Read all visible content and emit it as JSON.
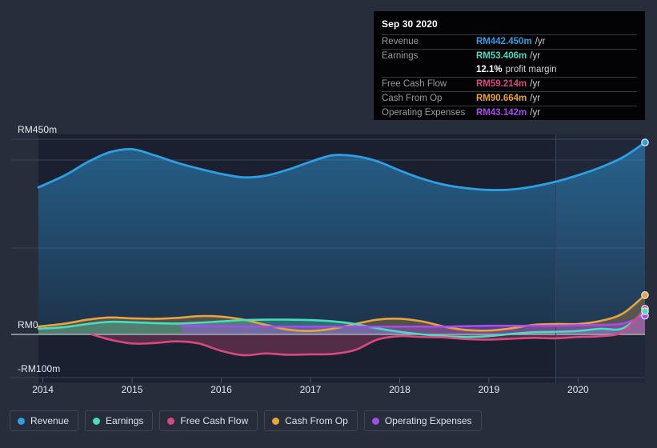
{
  "chart_data": {
    "type": "area",
    "title": "",
    "xlabel": "",
    "ylabel": "",
    "currency_prefix": "RM",
    "ylim": [
      -100,
      450
    ],
    "y_ticks": [
      {
        "value": 450,
        "label": "RM450m"
      },
      {
        "value": 0,
        "label": "RM0"
      },
      {
        "value": -100,
        "label": "-RM100m"
      }
    ],
    "x_ticks": [
      "2014",
      "2015",
      "2016",
      "2017",
      "2018",
      "2019",
      "2020"
    ],
    "grid": true,
    "legend_position": "bottom-left",
    "forecast_divider_year": 2019.75,
    "series": [
      {
        "name": "Revenue",
        "color": "#2f9fe3",
        "x": [
          2013.95,
          2014.25,
          2014.5,
          2014.75,
          2015.0,
          2015.25,
          2015.5,
          2015.75,
          2016.0,
          2016.25,
          2016.5,
          2016.75,
          2017.0,
          2017.25,
          2017.5,
          2017.75,
          2018.0,
          2018.25,
          2018.5,
          2018.75,
          2019.0,
          2019.25,
          2019.5,
          2019.75,
          2020.0,
          2020.25,
          2020.5,
          2020.75
        ],
        "values": [
          339,
          367,
          397,
          420,
          427,
          413,
          396,
          382,
          370,
          362,
          366,
          380,
          398,
          413,
          411,
          399,
          378,
          359,
          345,
          337,
          333,
          334,
          341,
          352,
          367,
          385,
          408,
          442.45
        ]
      },
      {
        "name": "Earnings",
        "color": "#4adbc0",
        "x": [
          2013.95,
          2014.25,
          2014.5,
          2014.75,
          2015.0,
          2015.25,
          2015.5,
          2015.75,
          2016.0,
          2016.25,
          2016.5,
          2016.75,
          2017.0,
          2017.25,
          2017.5,
          2017.75,
          2018.0,
          2018.25,
          2018.5,
          2018.75,
          2019.0,
          2019.25,
          2019.5,
          2019.75,
          2020.0,
          2020.25,
          2020.5,
          2020.75
        ],
        "values": [
          13,
          17,
          24,
          29,
          28,
          26,
          25,
          27,
          30,
          33,
          34,
          34,
          33,
          30,
          24,
          14,
          6,
          0,
          -4,
          -6,
          -4,
          1,
          5,
          6,
          8,
          13,
          14,
          53.406
        ]
      },
      {
        "name": "Free Cash Flow",
        "color": "#d64a7f",
        "x": [
          2014.55,
          2014.75,
          2015.0,
          2015.25,
          2015.5,
          2015.75,
          2016.0,
          2016.25,
          2016.5,
          2016.75,
          2017.0,
          2017.25,
          2017.5,
          2017.75,
          2018.0,
          2018.25,
          2018.5,
          2018.75,
          2019.0,
          2019.25,
          2019.5,
          2019.75,
          2020.0,
          2020.25,
          2020.5,
          2020.75
        ],
        "values": [
          0,
          -12,
          -21,
          -20,
          -16,
          -21,
          -38,
          -48,
          -44,
          -47,
          -46,
          -45,
          -36,
          -12,
          -4,
          -6,
          -7,
          -11,
          -12,
          -10,
          -8,
          -9,
          -6,
          -4,
          6,
          59.214
        ]
      },
      {
        "name": "Cash From Op",
        "color": "#e8a33d",
        "x": [
          2013.95,
          2014.25,
          2014.5,
          2014.75,
          2015.0,
          2015.25,
          2015.5,
          2015.75,
          2016.0,
          2016.25,
          2016.5,
          2016.75,
          2017.0,
          2017.25,
          2017.5,
          2017.75,
          2018.0,
          2018.25,
          2018.5,
          2018.75,
          2019.0,
          2019.25,
          2019.5,
          2019.75,
          2020.0,
          2020.25,
          2020.5,
          2020.75
        ],
        "values": [
          18,
          25,
          34,
          39,
          37,
          36,
          38,
          42,
          41,
          34,
          22,
          11,
          8,
          13,
          24,
          34,
          36,
          30,
          18,
          10,
          9,
          14,
          22,
          24,
          24,
          31,
          48,
          90.664
        ]
      },
      {
        "name": "Operating Expenses",
        "color": "#a44dec",
        "x": [
          2015.55,
          2015.75,
          2016.0,
          2016.25,
          2016.5,
          2016.75,
          2017.0,
          2017.25,
          2017.5,
          2017.75,
          2018.0,
          2018.25,
          2018.5,
          2018.75,
          2019.0,
          2019.25,
          2019.5,
          2019.75,
          2020.0,
          2020.25,
          2020.5,
          2020.75
        ],
        "values": [
          20,
          20,
          19,
          18,
          18,
          18,
          18,
          18,
          18,
          18,
          18,
          18,
          18,
          19,
          20,
          20,
          20,
          20,
          21,
          22,
          25,
          43.142
        ]
      }
    ]
  },
  "tooltip": {
    "date": "Sep 30 2020",
    "rows": [
      {
        "name": "Revenue",
        "value": "RM442.450m",
        "unit": "/yr",
        "color": "#2f9fe3"
      },
      {
        "name": "Earnings",
        "value": "RM53.406m",
        "unit": "/yr",
        "color": "#4adbc0"
      },
      {
        "name": "",
        "value": "12.1%",
        "unit": "profit margin",
        "color": "#ffffff"
      },
      {
        "name": "Free Cash Flow",
        "value": "RM59.214m",
        "unit": "/yr",
        "color": "#d64a7f"
      },
      {
        "name": "Cash From Op",
        "value": "RM90.664m",
        "unit": "/yr",
        "color": "#e8a33d"
      },
      {
        "name": "Operating Expenses",
        "value": "RM43.142m",
        "unit": "/yr",
        "color": "#a44dec"
      }
    ]
  },
  "legend": {
    "items": [
      {
        "label": "Revenue",
        "color": "#2f9fe3"
      },
      {
        "label": "Earnings",
        "color": "#4adbc0"
      },
      {
        "label": "Free Cash Flow",
        "color": "#d64a7f"
      },
      {
        "label": "Cash From Op",
        "color": "#e8a33d"
      },
      {
        "label": "Operating Expenses",
        "color": "#a44dec"
      }
    ]
  },
  "axes": {
    "y_labels": [
      "RM450m",
      "RM0",
      "-RM100m"
    ],
    "x_labels": [
      "2014",
      "2015",
      "2016",
      "2017",
      "2018",
      "2019",
      "2020"
    ]
  }
}
